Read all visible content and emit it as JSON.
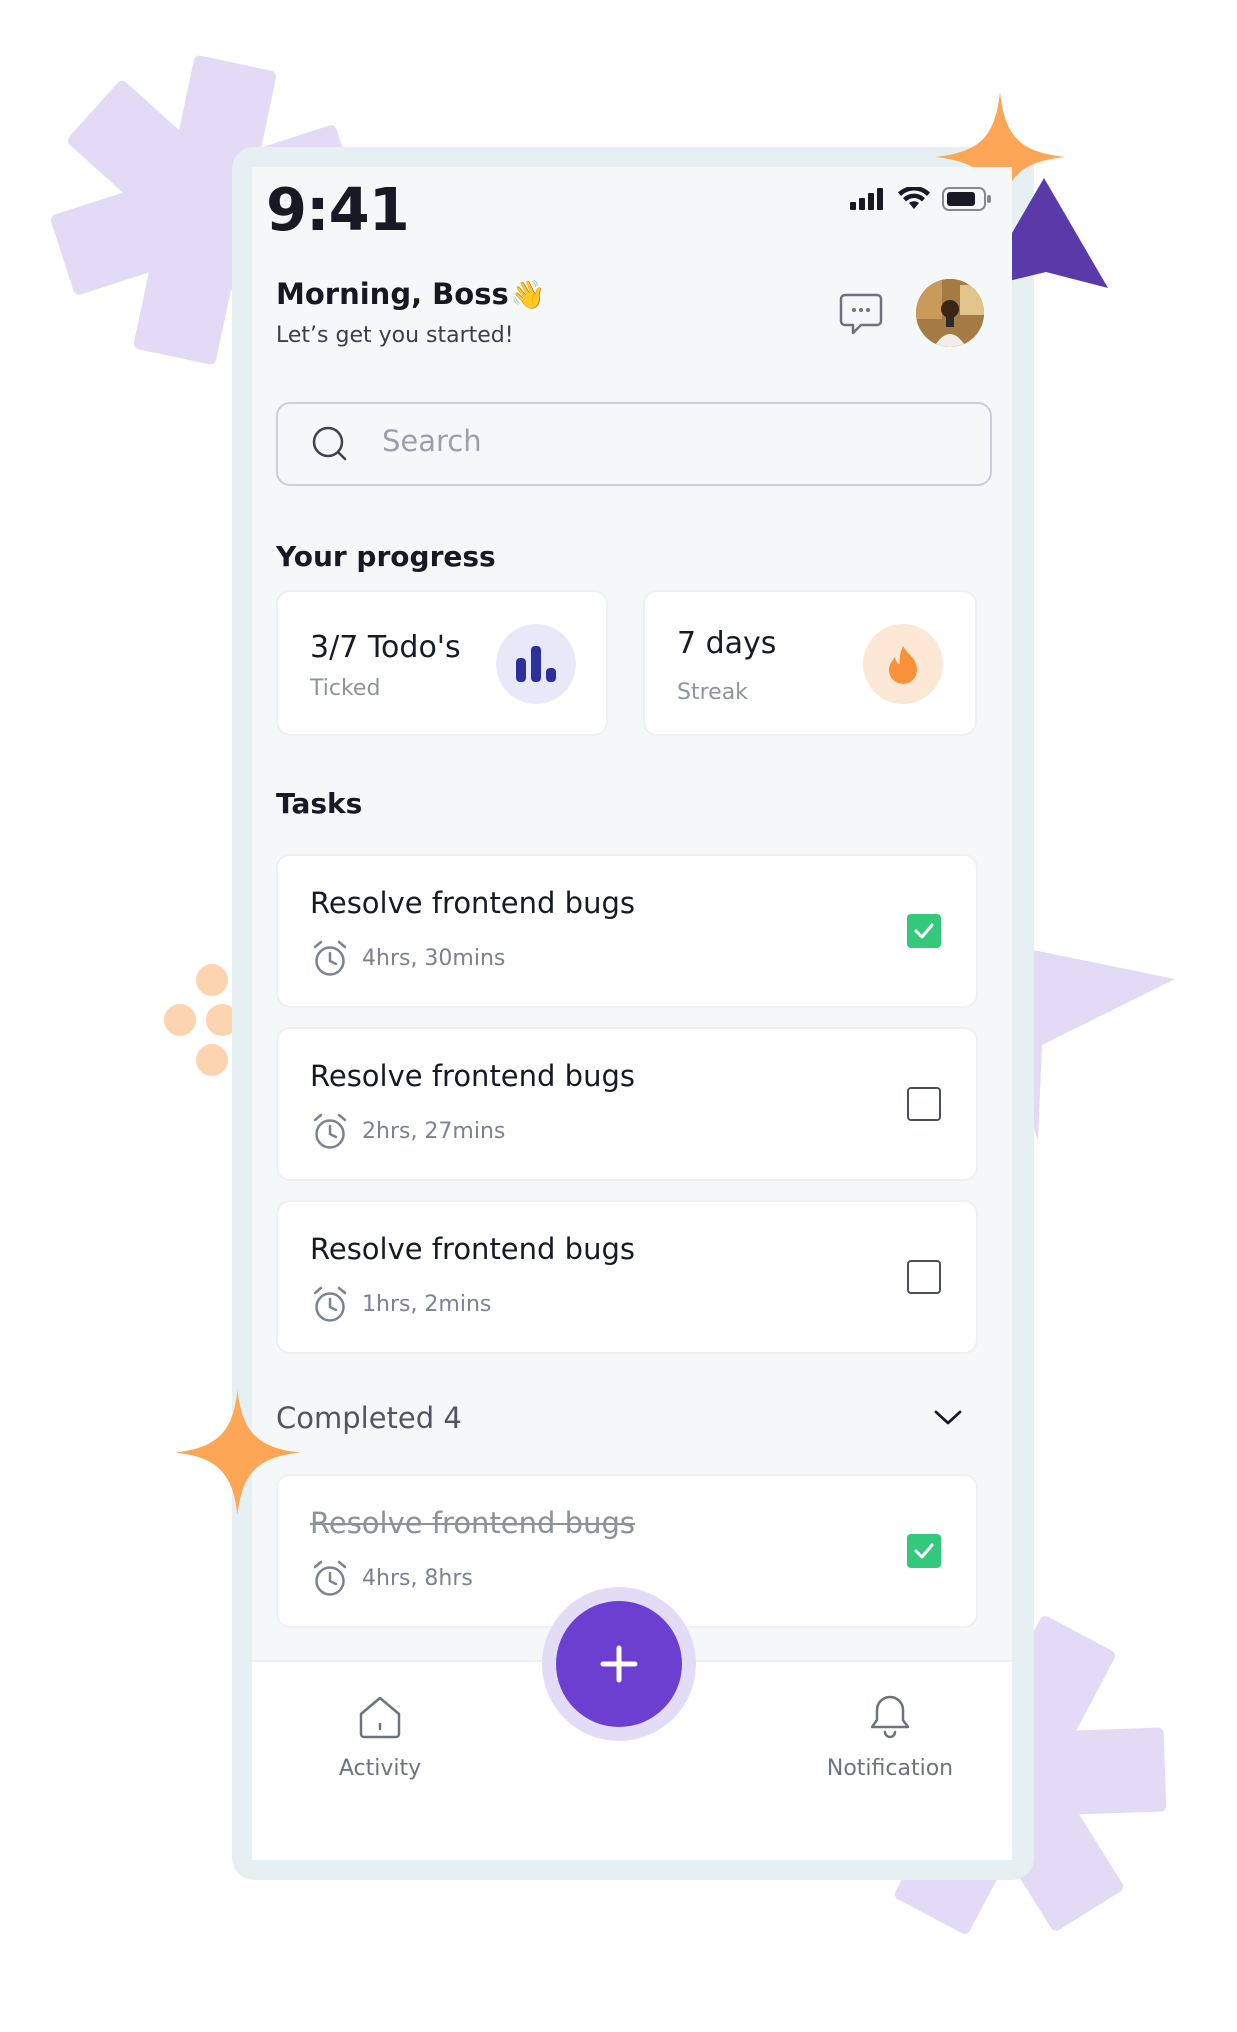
{
  "status_bar": {
    "time": "9:41"
  },
  "header": {
    "greeting": "Morning, Boss",
    "wave_emoji": "👋",
    "subtitle": "Let’s get you started!"
  },
  "search": {
    "placeholder": "Search"
  },
  "progress": {
    "title": "Your progress",
    "cards": [
      {
        "value": "3/7 Todo's",
        "label": "Ticked",
        "icon": "bar-chart-icon"
      },
      {
        "value": "7 days",
        "label": "Streak",
        "icon": "flame-icon"
      }
    ]
  },
  "tasks": {
    "title": "Tasks",
    "items": [
      {
        "title": "Resolve frontend bugs",
        "duration": "4hrs, 30mins",
        "checked": true
      },
      {
        "title": "Resolve frontend bugs",
        "duration": "2hrs, 27mins",
        "checked": false
      },
      {
        "title": "Resolve frontend bugs",
        "duration": "1hrs, 2mins",
        "checked": false
      }
    ]
  },
  "completed": {
    "label": "Completed 4",
    "items": [
      {
        "title": "Resolve frontend bugs",
        "duration": "4hrs, 8hrs",
        "checked": true
      }
    ]
  },
  "bottom_nav": {
    "items": [
      {
        "label": "Activity",
        "icon": "home-icon"
      },
      {
        "label": "Notification",
        "icon": "bell-icon"
      }
    ],
    "fab_icon": "plus-icon"
  },
  "colors": {
    "accent": "#6c3fd0",
    "check_green": "#33c87a",
    "deco_lavender": "#e3dbf6",
    "deco_orange": "#fda655",
    "deco_purple": "#5a3aa8"
  }
}
